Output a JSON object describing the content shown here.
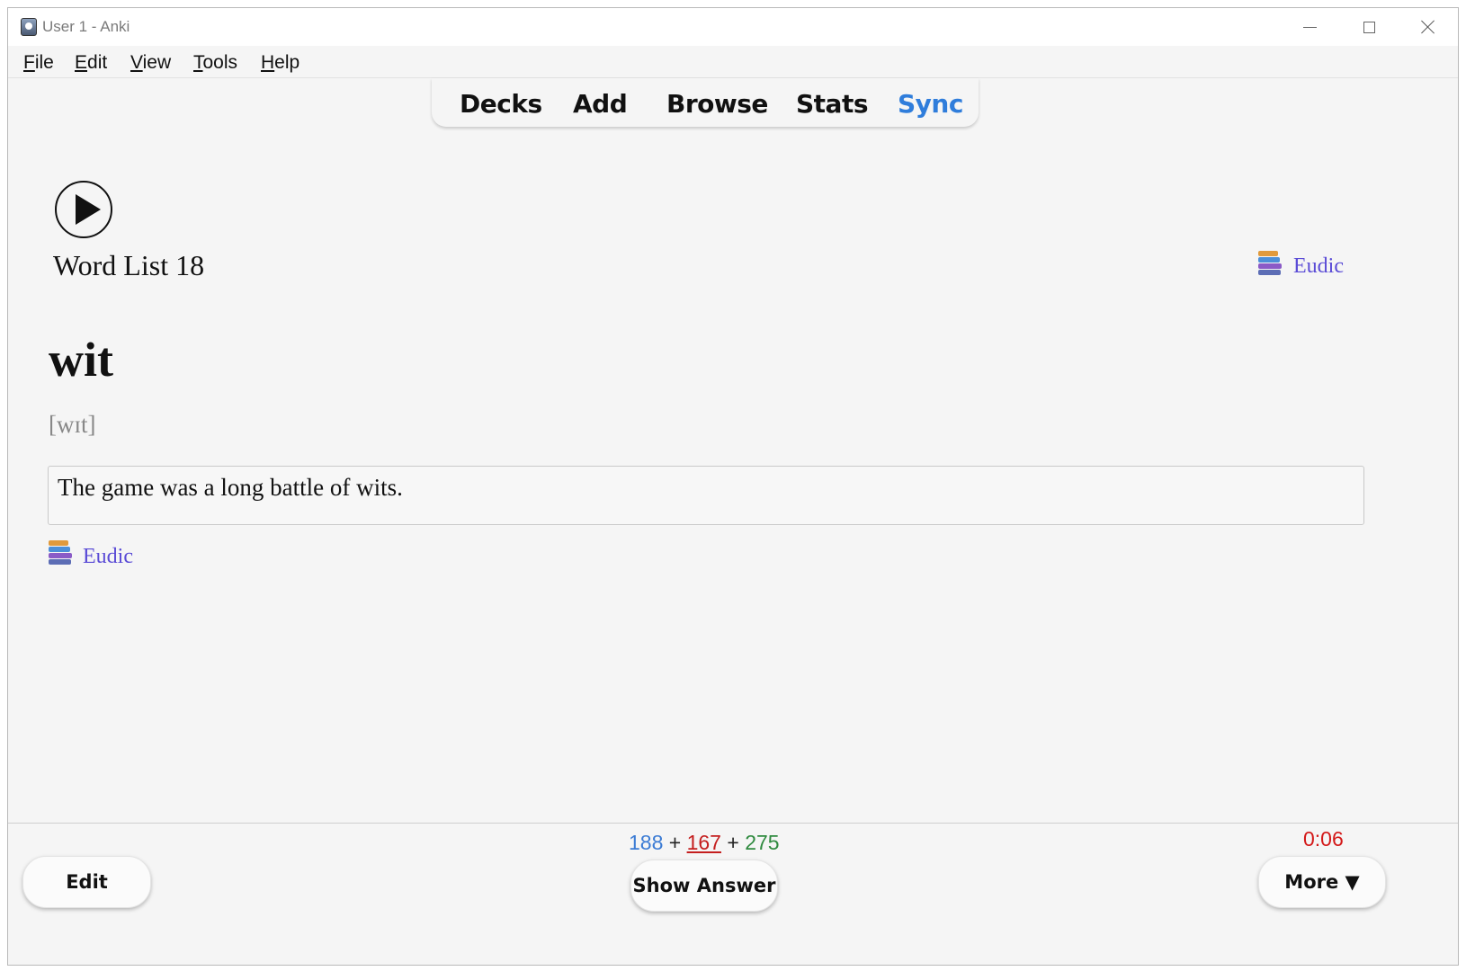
{
  "window": {
    "title": "User 1 - Anki"
  },
  "menu": {
    "items": [
      {
        "label": "File",
        "accel": "F",
        "rest": "ile"
      },
      {
        "label": "Edit",
        "accel": "E",
        "rest": "dit"
      },
      {
        "label": "View",
        "accel": "V",
        "rest": "iew"
      },
      {
        "label": "Tools",
        "accel": "T",
        "rest": "ools"
      },
      {
        "label": "Help",
        "accel": "H",
        "rest": "elp"
      }
    ]
  },
  "toolbar": {
    "decks": "Decks",
    "add": "Add",
    "browse": "Browse",
    "stats": "Stats",
    "sync": "Sync"
  },
  "card": {
    "deck_name": "Word List 18",
    "word": "wit",
    "phonetic": "[wɪt]",
    "example": "The game was a long battle of wits.",
    "dict_link_top": "Eudic",
    "dict_link_bottom": "Eudic"
  },
  "footer": {
    "count_new": "188",
    "count_learn": "167",
    "count_review": "275",
    "plus": "+",
    "timer": "0:06",
    "edit_label": "Edit",
    "show_answer_label": "Show Answer",
    "more_label": "More ▼"
  },
  "colors": {
    "sync_accent": "#2f7ddb",
    "new": "#3b7bd4",
    "learn": "#c41e1e",
    "review": "#2f8a3f",
    "timer": "#d31818",
    "link": "#5a4bd6"
  }
}
